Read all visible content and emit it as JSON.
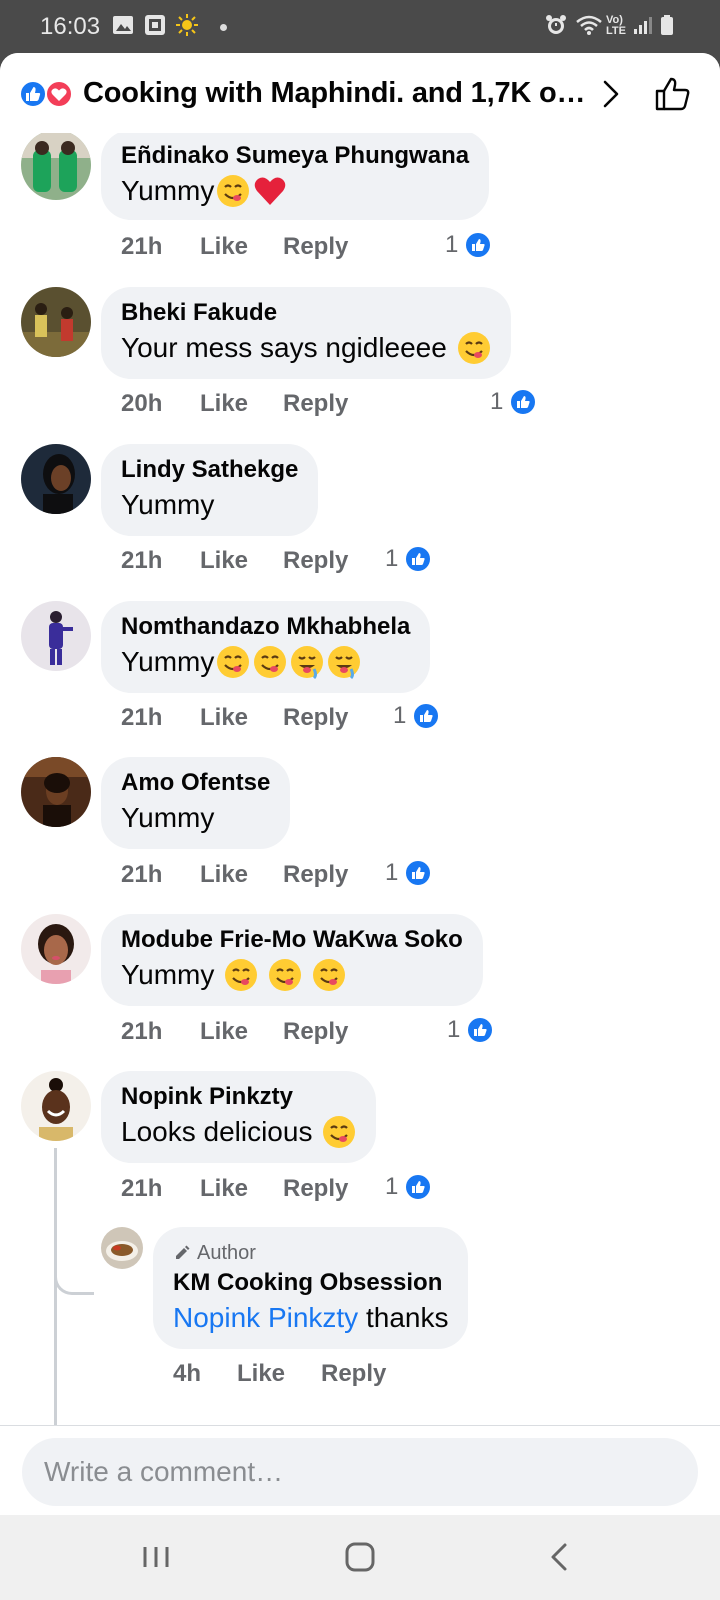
{
  "status_bar": {
    "time": "16:03",
    "icons": [
      "gallery-icon",
      "app-icon",
      "weather-sun-icon",
      "notification-dot",
      "alarm-icon",
      "wifi-icon",
      "volte-icon",
      "signal-icon",
      "battery-icon"
    ],
    "volte_label": "Vo) LTE"
  },
  "header": {
    "title": "Cooking with Maphindi. and 1,7K o…",
    "reactions": [
      "like-reaction-icon",
      "love-reaction-icon"
    ],
    "chevron": "chevron-right-icon",
    "thumb": "thumbs-up-outline-icon"
  },
  "actions": {
    "like": "Like",
    "reply": "Reply"
  },
  "comments": [
    {
      "name": "Eñdinako Sumeya Phungwana",
      "text": "Yummy",
      "emojis": [
        "savoring-face-emoji",
        "red-heart-emoji"
      ],
      "time": "21h",
      "likes": "1"
    },
    {
      "name": "Bheki Fakude",
      "text": "Your mess says ngidleeee ",
      "emojis": [
        "savoring-face-emoji"
      ],
      "time": "20h",
      "likes": "1"
    },
    {
      "name": "Lindy Sathekge",
      "text": "Yummy",
      "emojis": [],
      "time": "21h",
      "likes": "1"
    },
    {
      "name": "Nomthandazo Mkhabhela",
      "text": "Yummy",
      "emojis": [
        "savoring-face-emoji",
        "savoring-face-emoji",
        "drooling-face-emoji",
        "drooling-face-emoji"
      ],
      "time": "21h",
      "likes": "1"
    },
    {
      "name": "Amo Ofentse",
      "text": "Yummy",
      "emojis": [],
      "time": "21h",
      "likes": "1"
    },
    {
      "name": "Modube Frie-Mo WaKwa Soko",
      "text": "Yummy ",
      "emojis": [
        "savoring-face-emoji",
        "savoring-face-emoji",
        "savoring-face-emoji"
      ],
      "time": "21h",
      "likes": "1"
    },
    {
      "name": "Nopink Pinkzty",
      "text": "Looks delicious ",
      "emojis": [
        "savoring-face-emoji"
      ],
      "time": "21h",
      "likes": "1"
    }
  ],
  "reply": {
    "badge": "Author",
    "name": "KM Cooking Obsession",
    "mention": "Nopink Pinkzty",
    "text": " thanks",
    "time": "4h"
  },
  "composer": {
    "placeholder": "Write a comment…"
  },
  "nav": [
    "recent-apps-icon",
    "home-icon",
    "back-icon"
  ],
  "colors": {
    "facebook_blue": "#1877f2",
    "love_red": "#f33e58",
    "bubble": "#f0f2f5",
    "meta_text": "#65676b"
  }
}
